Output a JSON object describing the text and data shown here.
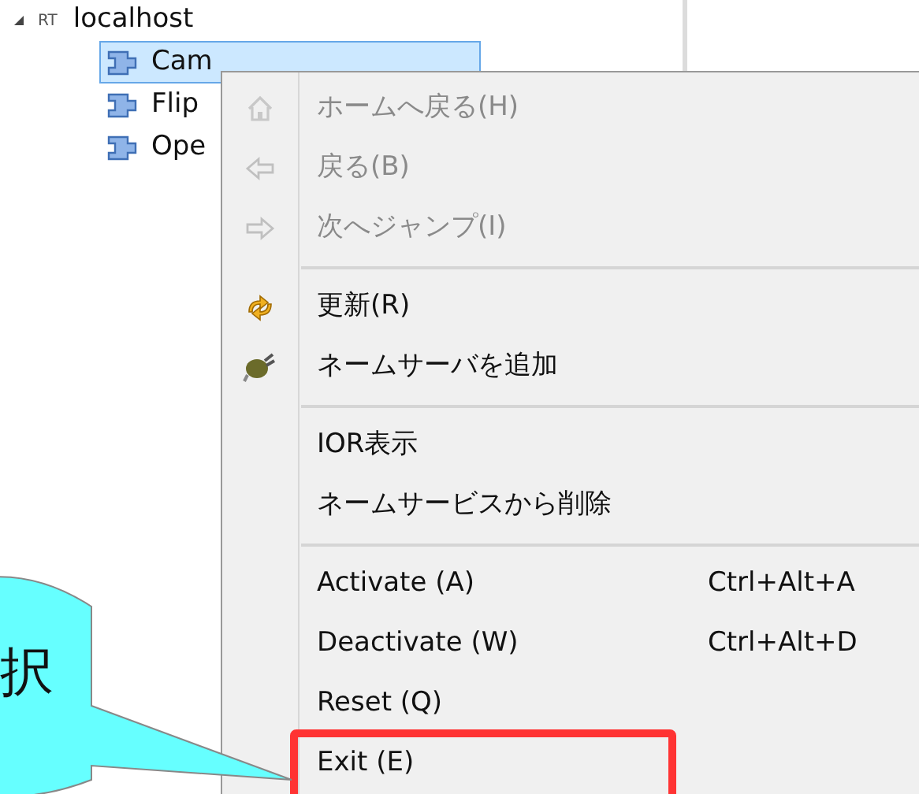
{
  "tree": {
    "badge": "RT",
    "label": "localhost",
    "expanded": true,
    "children": [
      {
        "label": "Cam",
        "selected": true
      },
      {
        "label": "Flip",
        "selected": false
      },
      {
        "label": "Ope",
        "selected": false
      }
    ]
  },
  "context_menu": {
    "sections": [
      [
        {
          "label": "ホームへ戻る(H)",
          "disabled": true
        },
        {
          "label": "戻る(B)",
          "disabled": true
        },
        {
          "label": "次へジャンプ(I)",
          "disabled": true
        }
      ],
      [
        {
          "label": "更新(R)",
          "disabled": false
        },
        {
          "label": "ネームサーバを追加",
          "disabled": false
        }
      ],
      [
        {
          "label": "IOR表示",
          "disabled": false
        },
        {
          "label": "ネームサービスから削除",
          "disabled": false
        }
      ],
      [
        {
          "label": "Activate (A)",
          "shortcut": "Ctrl+Alt+A",
          "disabled": false,
          "highlighted": false
        },
        {
          "label": "Deactivate (W)",
          "shortcut": "Ctrl+Alt+D",
          "disabled": false,
          "highlighted": false
        },
        {
          "label": "Reset (Q)",
          "disabled": false,
          "highlighted": false
        },
        {
          "label": "Exit (E)",
          "disabled": false,
          "highlighted": true
        }
      ]
    ]
  },
  "callout": {
    "text": "択"
  }
}
